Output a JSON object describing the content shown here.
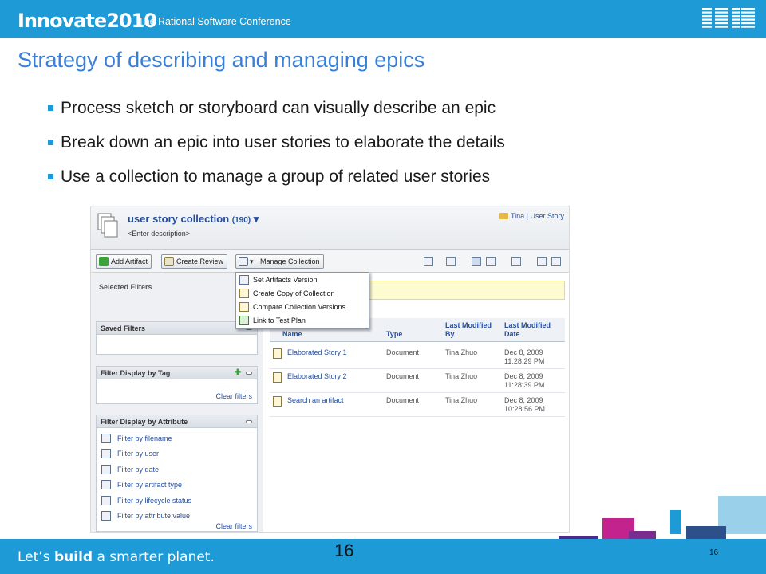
{
  "header": {
    "brand_main": "Innovate",
    "brand_year": "2010",
    "conference": "The Rational Software Conference",
    "logo_text": "IBM"
  },
  "slide": {
    "title": "Strategy of describing and managing epics",
    "bullets": [
      "Process sketch or storyboard can visually describe an epic",
      "Break down an epic into user stories to elaborate the details",
      "Use a collection to manage a group of related user stories"
    ],
    "page_number": "16",
    "page_number_small": "16"
  },
  "footer": {
    "tagline_pre": "Let’s ",
    "tagline_bold": "build",
    "tagline_post": " a smarter planet."
  },
  "app": {
    "collection_title": "user story collection",
    "collection_count": "(190)",
    "description": "<Enter description>",
    "user_link": "Tina | User Story",
    "toolbar": {
      "add_artifact": "Add Artifact",
      "create_review": "Create Review",
      "manage_collection": "Manage Collection"
    },
    "menu": [
      "Set Artifacts Version",
      "Create Copy of Collection",
      "Compare Collection Versions",
      "Link to Test Plan"
    ],
    "left": {
      "selected_filters": "Selected Filters",
      "saved_filters": "Saved Filters",
      "filter_by_tag": "Filter Display by Tag",
      "filter_by_attribute": "Filter Display by Attribute",
      "clear_filters": "Clear filters",
      "attribute_items": [
        "Filter by filename",
        "Filter by user",
        "Filter by date",
        "Filter by artifact type",
        "Filter by lifecycle status",
        "Filter by attribute value"
      ]
    },
    "table": {
      "headers": [
        "Name",
        "Type",
        "Last Modified By",
        "Last Modified Date"
      ],
      "rows": [
        {
          "name": "Elaborated Story 1",
          "type": "Document",
          "by": "Tina Zhuo",
          "date": "Dec 8, 2009",
          "time": "11:28:29 PM"
        },
        {
          "name": "Elaborated Story 2",
          "type": "Document",
          "by": "Tina Zhuo",
          "date": "Dec 8, 2009",
          "time": "11:28:39 PM"
        },
        {
          "name": "Search an artifact",
          "type": "Document",
          "by": "Tina Zhuo",
          "date": "Dec 8, 2009",
          "time": "10:28:56 PM"
        }
      ]
    }
  },
  "colors": {
    "brand_blue": "#1e9bd6",
    "title_blue": "#3a7fd5",
    "link_blue": "#274e9c"
  }
}
